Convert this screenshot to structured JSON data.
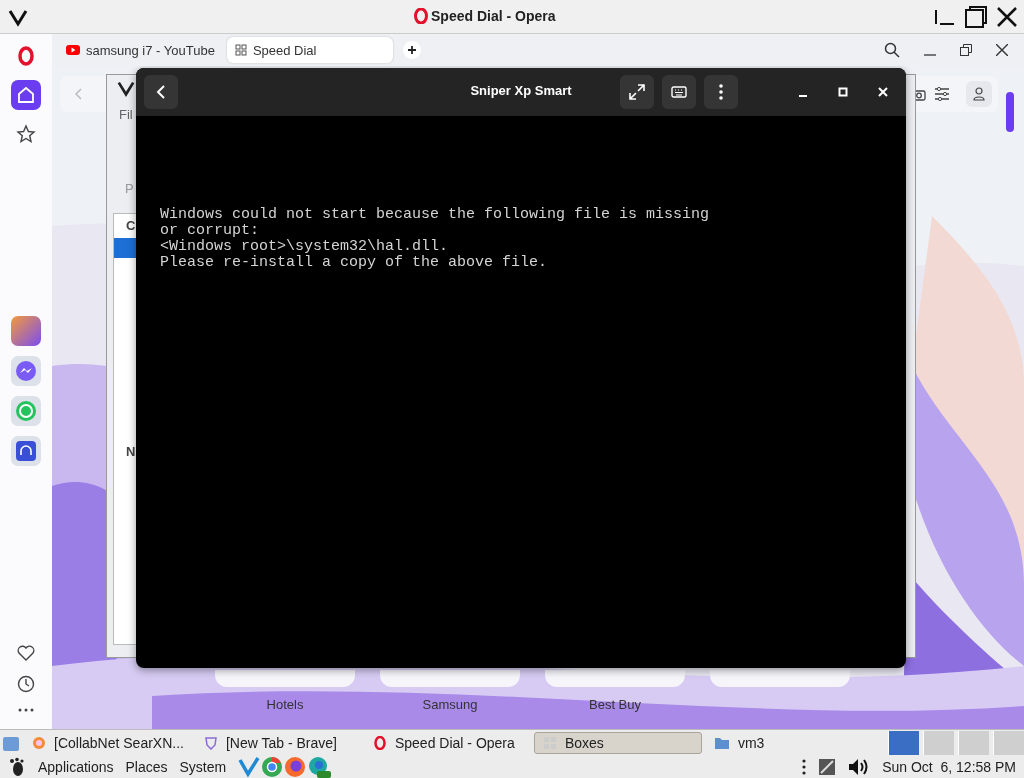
{
  "desktop_window": {
    "title": "Speed Dial - Opera"
  },
  "browser": {
    "tabs": [
      {
        "label": "samsung i7 - YouTube",
        "selected": false
      },
      {
        "label": "Speed Dial",
        "selected": true
      }
    ],
    "speed_dial": [
      "Hotels",
      "Samsung",
      "Best Buy"
    ]
  },
  "background_window": {
    "menu_fragment": "Fil",
    "fragments": [
      "P",
      "C",
      "N"
    ]
  },
  "vm_window": {
    "title": "Sniper Xp Smart",
    "console_lines": [
      "Windows could not start because the following file is missing",
      "or corrupt:",
      "<Windows root>\\system32\\hal.dll.",
      "Please re-install a copy of the above file."
    ]
  },
  "taskbar": {
    "tasks": [
      {
        "kind": "firefox",
        "label": "[CollabNet SearXN...",
        "selected": false
      },
      {
        "kind": "brave",
        "label": "[New Tab - Brave]",
        "selected": false
      },
      {
        "kind": "opera",
        "label": "Speed Dial - Opera",
        "selected": false
      },
      {
        "kind": "boxes",
        "label": "Boxes",
        "selected": true
      },
      {
        "kind": "folder",
        "label": "vm3",
        "selected": false
      }
    ],
    "menus": [
      "Applications",
      "Places",
      "System"
    ],
    "clock": "Sun Oct  6, 12:58 PM"
  }
}
